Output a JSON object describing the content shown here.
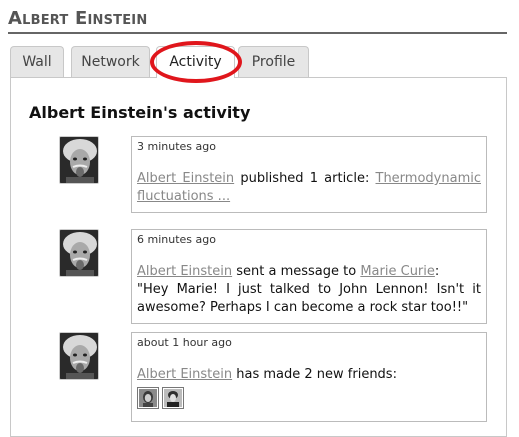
{
  "header": {
    "title": "Albert Einstein"
  },
  "tabs": [
    {
      "label": "Wall",
      "active": false
    },
    {
      "label": "Network",
      "active": false
    },
    {
      "label": "Activity",
      "active": true
    },
    {
      "label": "Profile",
      "active": false
    }
  ],
  "activity": {
    "title": "Albert Einstein's activity",
    "entries": [
      {
        "time": "3 minutes ago",
        "actor": "Albert Einstein",
        "action": " published 1 article: ",
        "object": "Thermodynamic fluctuations ..."
      },
      {
        "time": "6 minutes ago",
        "actor": "Albert Einstein",
        "action": " sent a message to ",
        "object": "Marie Curie",
        "suffix": ":",
        "message": "\"Hey Marie! I just talked to John Lennon! Isn't it awesome? Perhaps I can become a rock star too!!\""
      },
      {
        "time": "about 1 hour ago",
        "actor": "Albert Einstein",
        "action": " has made 2 new friends:",
        "friends": [
          "friend-avatar",
          "friend-avatar"
        ]
      }
    ]
  },
  "colors": {
    "highlight": "#e0161c",
    "link": "#888888",
    "tab_bg": "#e6e6e6"
  }
}
